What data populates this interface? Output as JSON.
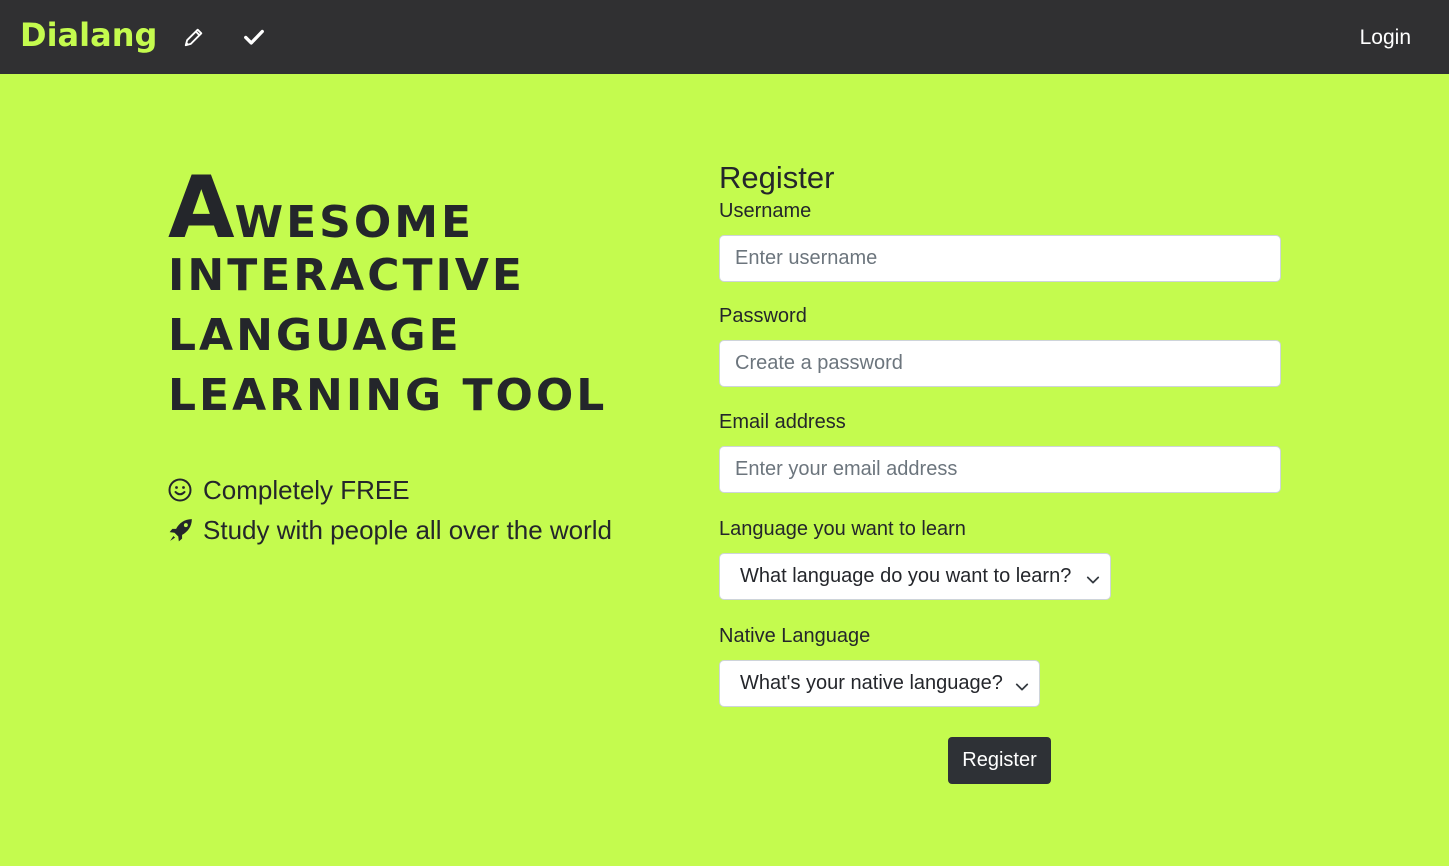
{
  "nav": {
    "brand": "Dialang",
    "login_label": "Login",
    "icons": [
      "pencil-icon",
      "check-icon"
    ]
  },
  "hero": {
    "title_first_letter": "A",
    "title_line1_rest": "wesome",
    "title_line2": "interactive",
    "title_line3": "language",
    "title_line4": "learning tool",
    "features": [
      {
        "icon": "smiley-icon",
        "text": "Completely FREE"
      },
      {
        "icon": "rocket-icon",
        "text": "Study with people all over the world"
      }
    ]
  },
  "form": {
    "title": "Register",
    "username": {
      "label": "Username",
      "placeholder": "Enter username",
      "value": ""
    },
    "password": {
      "label": "Password",
      "placeholder": "Create a password",
      "value": ""
    },
    "email": {
      "label": "Email address",
      "placeholder": "Enter your email address",
      "value": ""
    },
    "learn_language": {
      "label": "Language you want to learn",
      "selected": "What language do you want to learn?"
    },
    "native_language": {
      "label": "Native Language",
      "selected": "What's your native language?"
    },
    "submit_label": "Register"
  },
  "colors": {
    "background": "#c4fb4e",
    "navbar": "#303032",
    "brand": "#c4fb4e",
    "text_dark": "#24262b",
    "button": "#2e3136"
  }
}
